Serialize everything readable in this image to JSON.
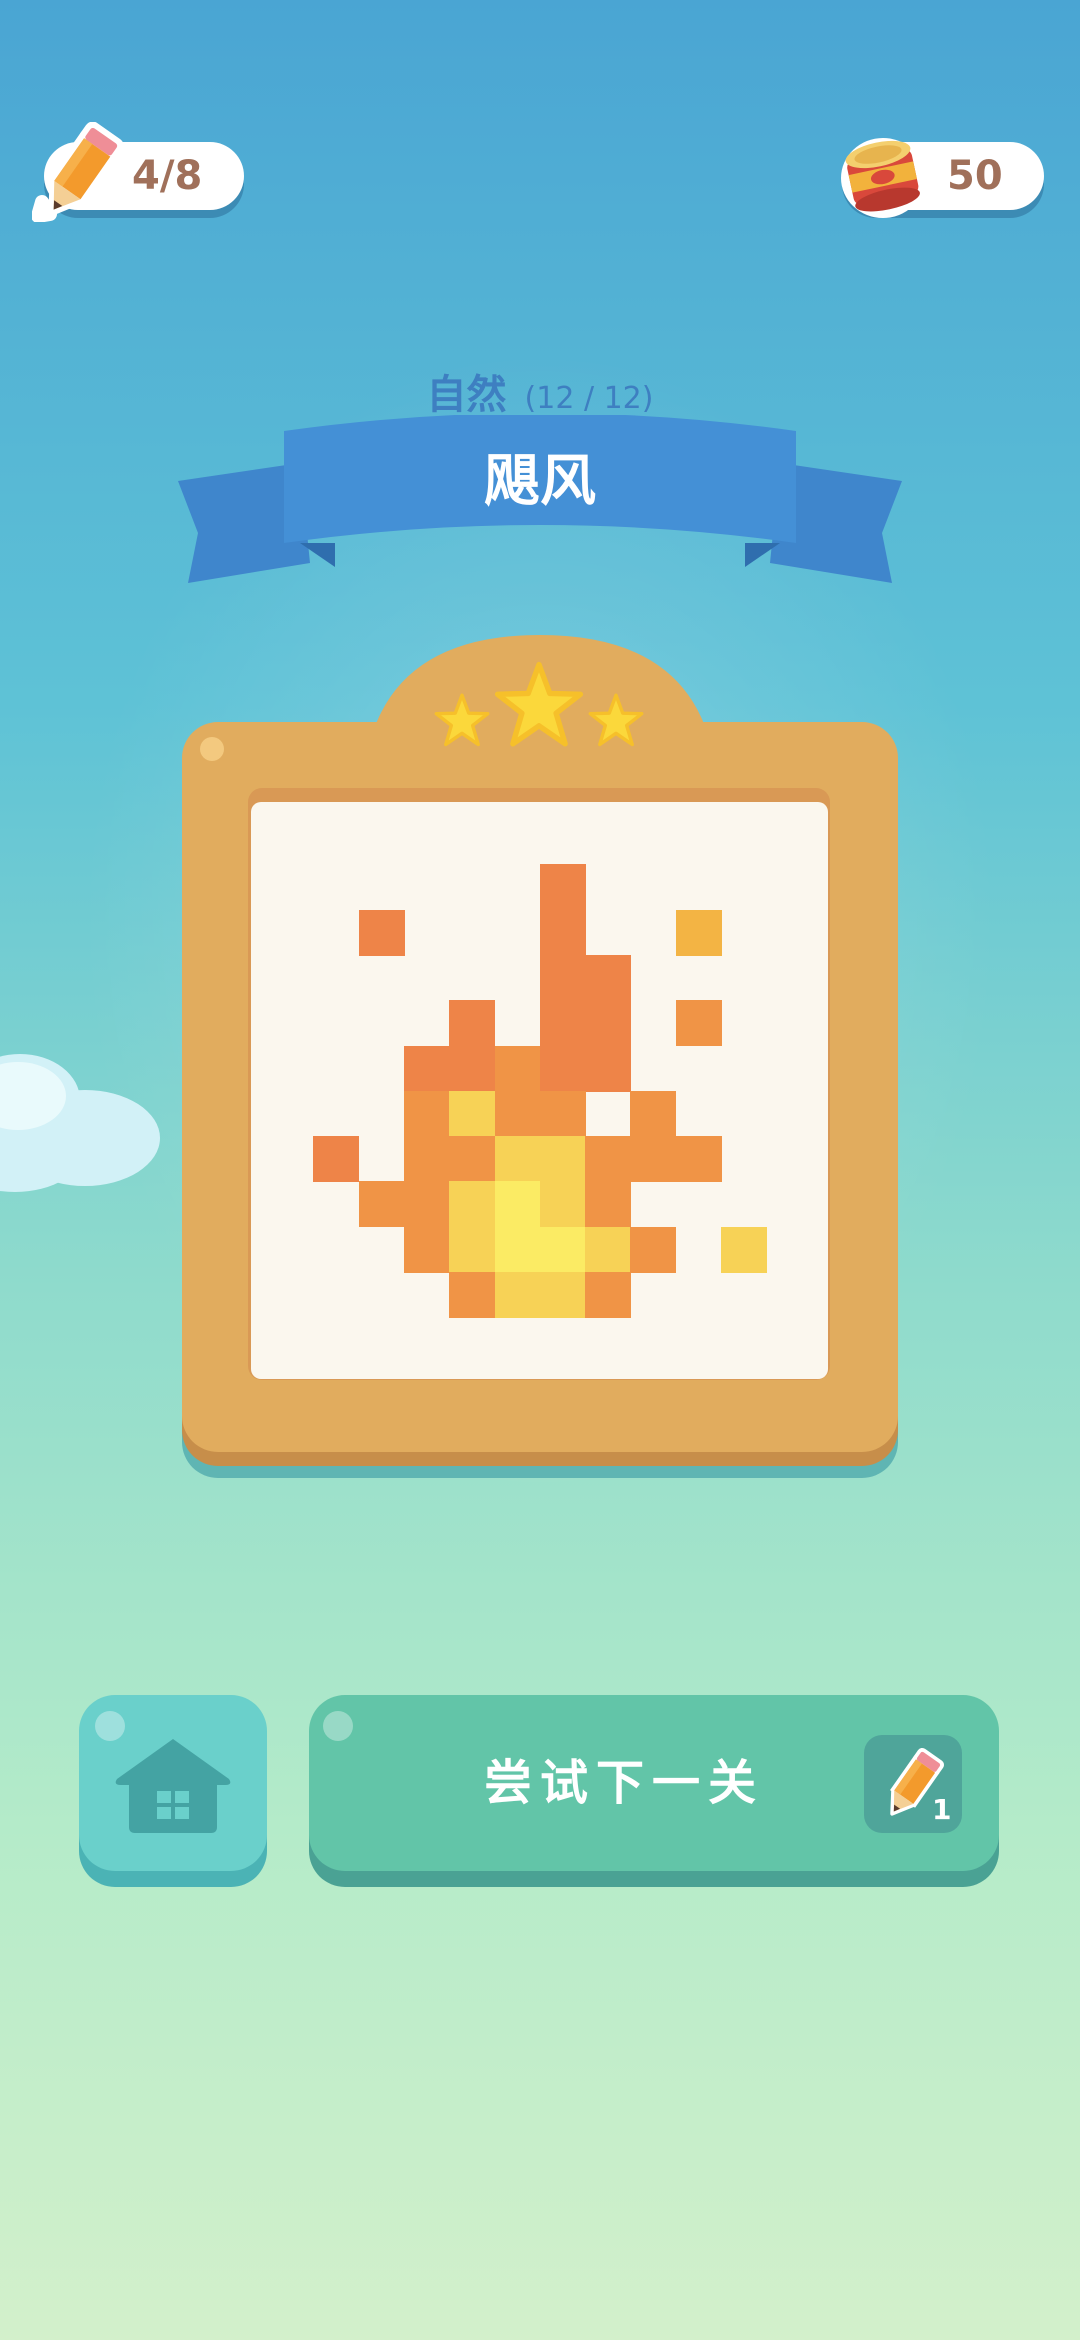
{
  "hud": {
    "pencils": "4/8",
    "coins": "50"
  },
  "category": {
    "name": "自然",
    "progress": "(12 / 12)"
  },
  "level": {
    "title": "飓风",
    "stars_earned": 3,
    "stars_total": 3
  },
  "buttons": {
    "next_label": "尝试下一关",
    "next_cost": "1"
  },
  "pixel_art": {
    "grid_size": 12,
    "colors": {
      "r": "#ee8448",
      "o": "#f09446",
      "g": "#f3b444",
      "y": "#f7d256",
      "l": "#fbeb64"
    },
    "rows": [
      "............",
      "......r.....",
      "..r...r..g..",
      "......rr....",
      "....r.rr.o..",
      "...rrorr....",
      "...oyoo.o...",
      ".r.ooyyooo..",
      "..ooylyo....",
      "...oyllyo.y.",
      "....oyyo....",
      "............"
    ]
  }
}
